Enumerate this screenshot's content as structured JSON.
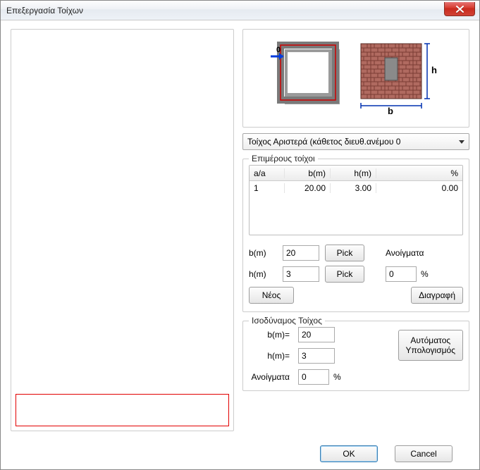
{
  "window": {
    "title": "Επεξεργασία Τοίχων"
  },
  "preview": {
    "origin_label": "0",
    "h_label": "h",
    "b_label": "b"
  },
  "dropdown": {
    "selected": "Τοίχος Αριστερά (κάθετος διευθ.ανέμου 0"
  },
  "table": {
    "title": "Επιμέρους τοίχοι",
    "headers": {
      "aa": "a/a",
      "b": "b(m)",
      "h": "h(m)",
      "p": "%"
    },
    "rows": [
      {
        "aa": "1",
        "b": "20.00",
        "h": "3.00",
        "p": "0.00"
      }
    ]
  },
  "form": {
    "b_label": "b(m)",
    "b_value": "20",
    "h_label": "h(m)",
    "h_value": "3",
    "pick_label": "Pick",
    "openings_label": "Ανοίγματα",
    "openings_value": "0",
    "openings_unit": "%",
    "new_label": "Νέος",
    "delete_label": "Διαγραφή"
  },
  "equivalent": {
    "title": "Ισοδύναμος Τοίχος",
    "b_label": "b(m)=",
    "b_value": "20",
    "h_label": "h(m)=",
    "h_value": "3",
    "openings_label": "Ανοίγματα",
    "openings_value": "0",
    "openings_unit": "%",
    "auto_label_line1": "Αυτόματος",
    "auto_label_line2": "Υπολογισμός"
  },
  "footer": {
    "ok": "OK",
    "cancel": "Cancel"
  }
}
